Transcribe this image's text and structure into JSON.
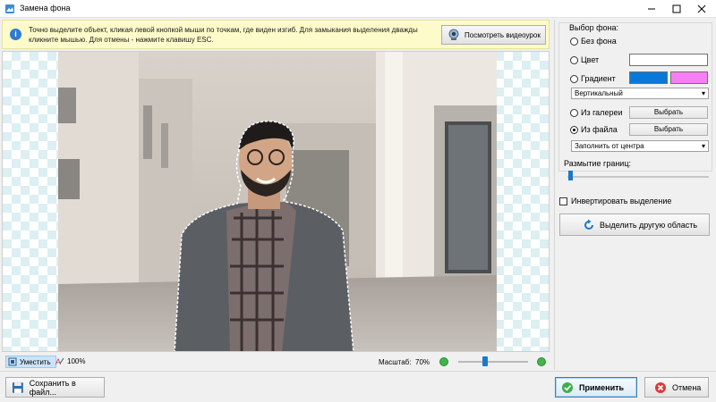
{
  "window": {
    "title": "Замена фона",
    "icon": "app-icon",
    "controls": [
      "minimize-icon",
      "maximize-icon",
      "close-icon"
    ]
  },
  "info": {
    "icon": "info-icon",
    "text": "Точно выделите объект, кликая левой кнопкой мыши по точкам, где виден изгиб. Для замыкания выделения дважды кликните мышью. Для отмены - нажмите клавишу ESC.",
    "video_button": "Посмотреть видеоурок"
  },
  "toolbar": {
    "fit_label": "Уместить",
    "zoom100_label": "100%",
    "scale_label": "Масштаб:",
    "scale_value": "70%"
  },
  "panel": {
    "background_title": "Выбор фона:",
    "options": {
      "no_background": "Без фона",
      "color": "Цвет",
      "gradient": "Градиент",
      "from_gallery": "Из галереи",
      "from_file": "Из файла"
    },
    "selected_option": "Из файла",
    "gradient_direction": "Вертикальный",
    "pick_label": "Выбрать",
    "fill_mode": "Заполнить от центра",
    "edge_blur_title": "Размытие границ:",
    "invert_label": "Инвертировать выделение",
    "invert_checked": false,
    "select_other_label": "Выделить другую область"
  },
  "colors": {
    "color_swatch": "#ffffff",
    "gradient_start": "#0a78d7",
    "gradient_end": "#f57ef3",
    "accent": "#1e78c8",
    "info_bar": "#fdfbc9"
  },
  "footer": {
    "save_label": "Сохранить в файл...",
    "apply_label": "Применить",
    "cancel_label": "Отмена"
  }
}
